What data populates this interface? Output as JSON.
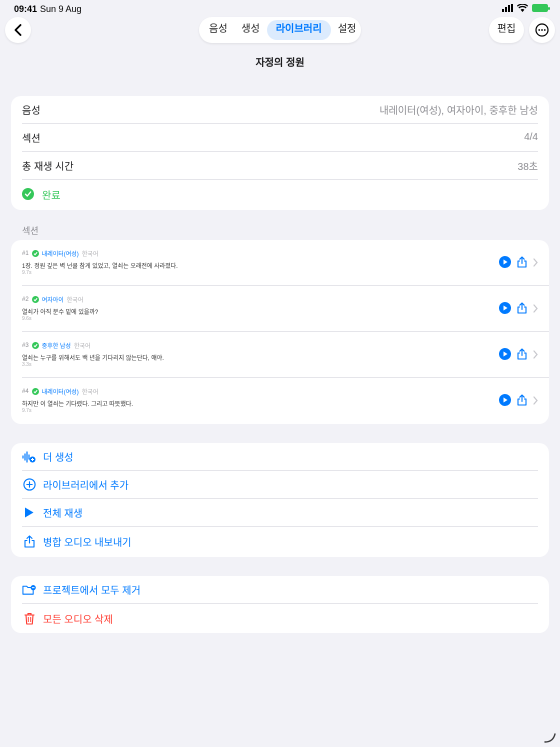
{
  "status": {
    "time": "09:41",
    "date": "Sun 9 Aug"
  },
  "nav": {
    "tabs": [
      {
        "label": "음성"
      },
      {
        "label": "생성"
      },
      {
        "label": "라이브러리"
      },
      {
        "label": "설정"
      }
    ],
    "active_tab": "라이브러리",
    "edit_label": "편집"
  },
  "page_title": "자정의 정원",
  "info": {
    "voice_label": "음성",
    "voice_value": "내레이터(여성), 여자아이, 중후한 남성",
    "sections_label": "섹션",
    "sections_value": "4/4",
    "duration_label": "총 재생 시간",
    "duration_value": "38초",
    "status_label": "완료"
  },
  "sections_header": "섹션",
  "sections": [
    {
      "num": "#1",
      "voice": "내레이터(여성)",
      "lang": "한국어",
      "text": "1장. 정원 깊은 벽 넌쿨 참게 있었고, 열쇠는 오래전에 사라졌다.",
      "duration": "9.7s"
    },
    {
      "num": "#2",
      "voice": "여자아이",
      "lang": "한국어",
      "text": "열쇠가 아직 분수 밑에 있을까?",
      "duration": "9.6s"
    },
    {
      "num": "#3",
      "voice": "중후한 남성",
      "lang": "한국어",
      "text": "열쇠는 누구를 위해서도 백 년을 기다리지 않는단다, 얘야.",
      "duration": "3.3s"
    },
    {
      "num": "#4",
      "voice": "내레이터(여성)",
      "lang": "한국어",
      "text": "하지만 이 열쇠는 기다렸다. 그리고 따뜻했다.",
      "duration": "9.7s"
    }
  ],
  "actions": {
    "generate_more": "더 생성",
    "add_from_library": "라이브러리에서 추가",
    "play_all": "전체 재생",
    "export_merged": "병합 오디오 내보내기"
  },
  "danger": {
    "remove_all": "프로젝트에서 모두 제거",
    "delete_audio": "모든 오디오 삭제"
  },
  "colors": {
    "accent": "#007aff",
    "success": "#34c759",
    "destructive": "#ff3b30",
    "background": "#f2f2f7"
  }
}
